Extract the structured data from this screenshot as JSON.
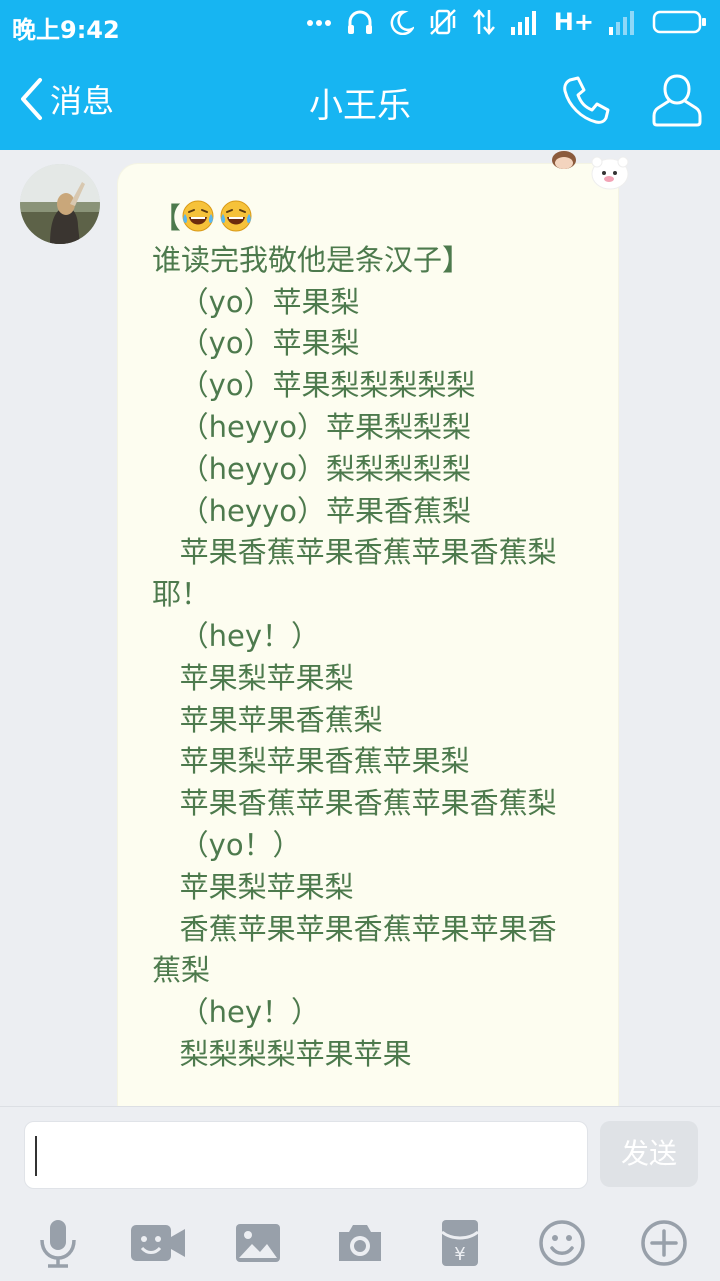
{
  "status_bar": {
    "time": "晚上9:42",
    "network": "H+",
    "icons": [
      "more-dots-icon",
      "headphones-icon",
      "moon-icon",
      "vibrate-off-icon",
      "data-arrows-icon",
      "signal-icon",
      "signal-weak-icon",
      "battery-icon"
    ]
  },
  "header": {
    "back_label": "消息",
    "title": "小王乐",
    "phone_icon": "phone-icon",
    "profile_icon": "profile-icon"
  },
  "message": {
    "lines": [
      {
        "text": "【",
        "suffix": "谁读完我敬他是条汉子】",
        "emoji": [
          "laughing-tears-emoji",
          "laughing-tears-emoji"
        ]
      },
      {
        "text": "   （yo）苹果梨"
      },
      {
        "text": "   （yo）苹果梨"
      },
      {
        "text": "   （yo）苹果梨梨梨梨梨"
      },
      {
        "text": "   （heyyo）苹果梨梨梨"
      },
      {
        "text": "   （heyyo）梨梨梨梨梨"
      },
      {
        "text": "   （heyyo）苹果香蕉梨"
      },
      {
        "text": "   苹果香蕉苹果香蕉苹果香蕉梨 耶！"
      },
      {
        "text": "   （hey！）"
      },
      {
        "text": "   苹果梨苹果梨"
      },
      {
        "text": "   苹果苹果香蕉梨"
      },
      {
        "text": "   苹果梨苹果香蕉苹果梨"
      },
      {
        "text": "   苹果香蕉苹果香蕉苹果香蕉梨"
      },
      {
        "text": "   （yo！）"
      },
      {
        "text": "   苹果梨苹果梨"
      },
      {
        "text": "   香蕉苹果苹果香蕉苹果苹果香蕉梨"
      },
      {
        "text": "   （hey！）"
      },
      {
        "text": "   梨梨梨梨苹果苹果"
      }
    ]
  },
  "input": {
    "value": "",
    "placeholder": "",
    "send_label": "发送"
  },
  "toolbar": {
    "items": [
      "microphone-icon",
      "video-emoji-icon",
      "image-icon",
      "camera-icon",
      "red-packet-icon",
      "emoji-icon",
      "plus-icon"
    ]
  },
  "colors": {
    "header_bg": "#17b5f2",
    "bubble_bg": "#fdfdf0",
    "message_text": "#4d7a4d",
    "chat_bg": "#eceef2"
  }
}
